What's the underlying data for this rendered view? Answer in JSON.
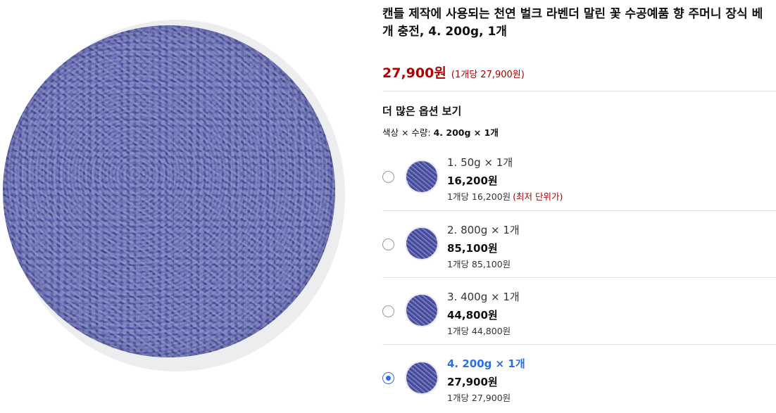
{
  "product": {
    "title": "캔들 제작에 사용되는 천연 벌크 라벤더 말린 꽃 수공예품 향 주머니 장식 베개 충전, 4. 200g, 1개",
    "price": "27,900원",
    "unit_price": "(1개당 27,900원)"
  },
  "options_section": {
    "more_options_label": "더 많은 옵션 보기",
    "summary_prefix": "색상 × 수량: ",
    "summary_value": "4. 200g × 1개"
  },
  "options": [
    {
      "label": "1. 50g × 1개",
      "price": "16,200원",
      "unit": "1개당 16,200원",
      "badge": "(최저 단위가)",
      "selected": false
    },
    {
      "label": "2. 800g × 1개",
      "price": "85,100원",
      "unit": "1개당 85,100원",
      "badge": "",
      "selected": false
    },
    {
      "label": "3. 400g × 1개",
      "price": "44,800원",
      "unit": "1개당 44,800원",
      "badge": "",
      "selected": false
    },
    {
      "label": "4. 200g × 1개",
      "price": "27,900원",
      "unit": "1개당 27,900원",
      "badge": "",
      "selected": true
    }
  ]
}
